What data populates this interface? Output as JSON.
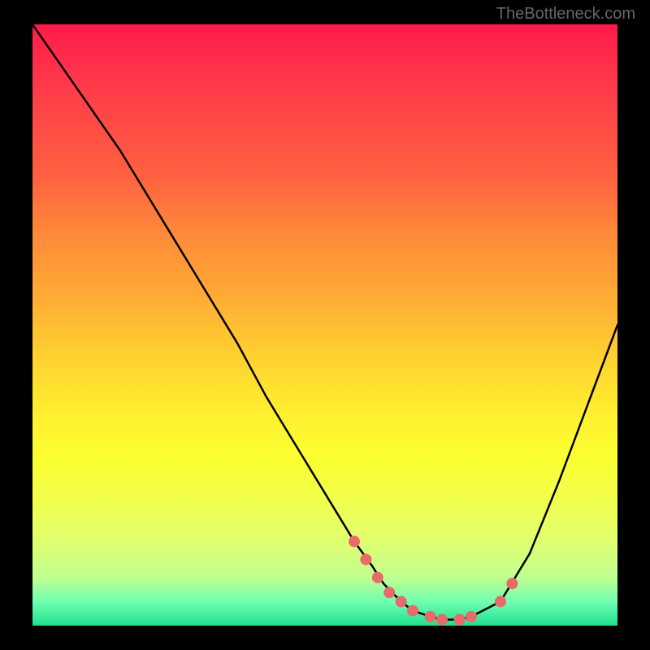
{
  "watermark": "TheBottleneck.com",
  "chart_data": {
    "type": "line",
    "title": "",
    "xlabel": "",
    "ylabel": "",
    "xlim": [
      0,
      100
    ],
    "ylim": [
      0,
      100
    ],
    "series": [
      {
        "name": "bottleneck-curve",
        "x": [
          0,
          5,
          10,
          15,
          20,
          25,
          30,
          35,
          40,
          45,
          50,
          55,
          58,
          60,
          63,
          65,
          68,
          70,
          73,
          75,
          80,
          85,
          90,
          95,
          100
        ],
        "y": [
          100,
          93,
          86,
          79,
          71,
          63,
          55,
          47,
          38,
          30,
          22,
          14,
          10,
          7,
          4,
          2.5,
          1.5,
          1,
          1,
          1.5,
          4,
          12,
          24,
          37,
          50
        ]
      }
    ],
    "markers": {
      "name": "highlight-points",
      "x": [
        55,
        57,
        59,
        61,
        63,
        65,
        68,
        70,
        73,
        75,
        80,
        82
      ],
      "y": [
        14,
        11,
        8,
        5.5,
        4,
        2.5,
        1.5,
        1,
        1,
        1.5,
        4,
        7
      ]
    }
  }
}
